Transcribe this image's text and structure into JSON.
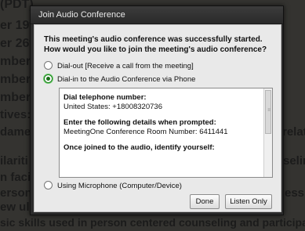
{
  "background": {
    "lines": [
      "(PDT)",
      "er 19t",
      "er 26t",
      "mber 2",
      "mber 9",
      "mber 1",
      "tives:",
      "dame",
      "relat",
      "ilariti",
      "seling",
      "n facil",
      "erson c",
      "essin",
      "ew ul",
      "sic skills used in person centered counseling and participa"
    ]
  },
  "dialog": {
    "title": "Join Audio Conference",
    "intro_line1": "This meeting's audio conference was successfully started.",
    "intro_line2": "How would you like to join the meeting's audio conference?",
    "options": {
      "dial_out": "Dial-out [Receive a call from the meeting]",
      "dial_in": "Dial-in to the Audio Conference via Phone",
      "microphone": "Using Microphone (Computer/Device)"
    },
    "selected_option": "dial_in",
    "info": {
      "dial_heading": "Dial telephone number:",
      "dial_number": "United States: +18008320736",
      "details_heading": "Enter the following details when prompted:",
      "details_value": "MeetingOne Conference Room Number: 6411441",
      "identify_heading": "Once joined to the audio, identify yourself:"
    },
    "buttons": {
      "done": "Done",
      "listen_only": "Listen Only"
    }
  }
}
